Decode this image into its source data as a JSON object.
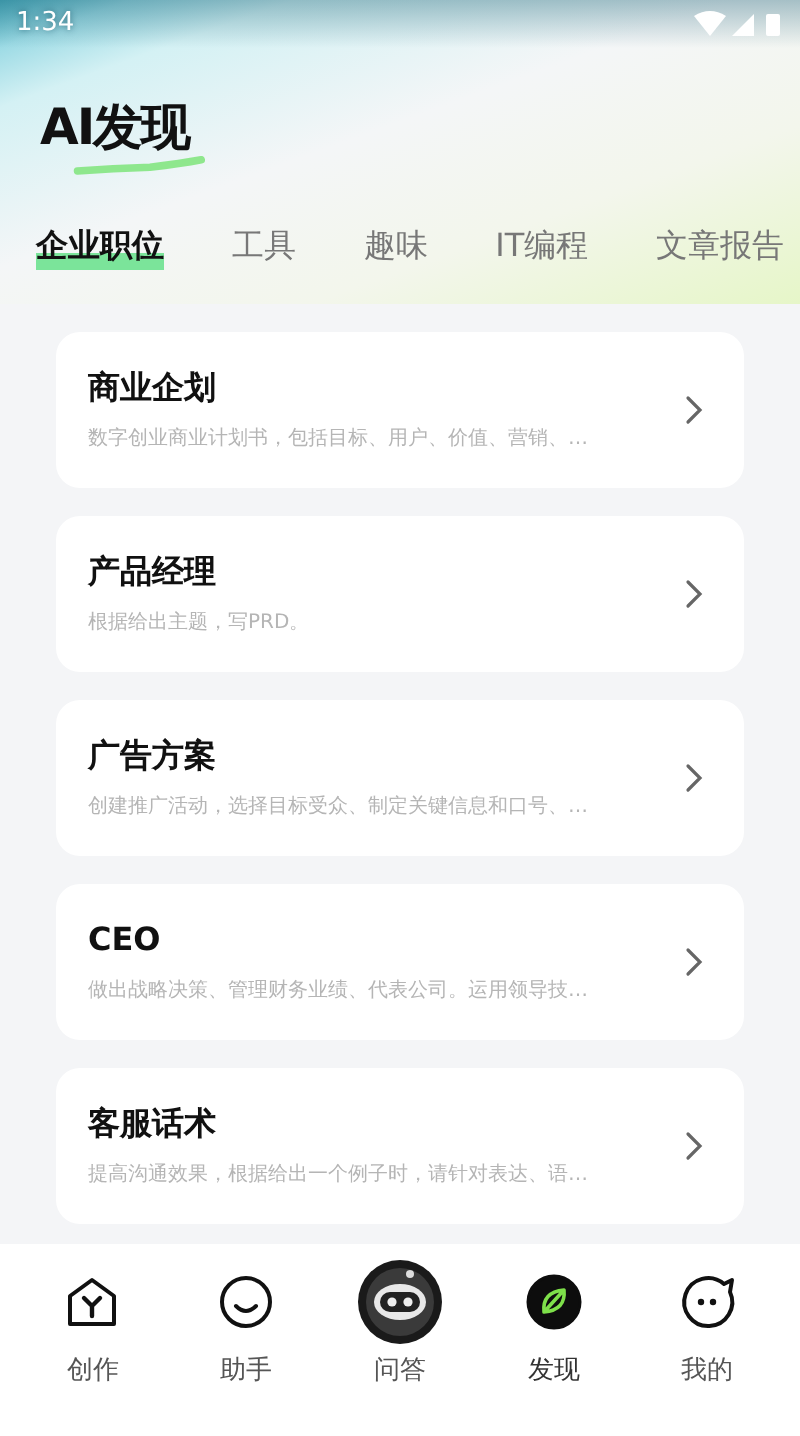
{
  "status_bar": {
    "time": "1:34"
  },
  "header": {
    "title": "AI发现"
  },
  "tabs": [
    {
      "label": "企业职位",
      "selected": true
    },
    {
      "label": "工具",
      "selected": false
    },
    {
      "label": "趣味",
      "selected": false
    },
    {
      "label": "IT编程",
      "selected": false
    },
    {
      "label": "文章报告",
      "selected": false
    }
  ],
  "cards": [
    {
      "title": "商业企划",
      "description": "数字创业商业计划书，包括目标、用户、价值、营销、…"
    },
    {
      "title": "产品经理",
      "description": "根据给出主题，写PRD。"
    },
    {
      "title": "广告方案",
      "description": "创建推广活动，选择目标受众、制定关键信息和口号、…"
    },
    {
      "title": "CEO",
      "description": "做出战略决策、管理财务业绩、代表公司。运用领导技…"
    },
    {
      "title": "客服话术",
      "description": "提高沟通效果，根据给出一个例子时，请针对表达、语…"
    }
  ],
  "bottom_nav": [
    {
      "kind": "home",
      "label": "创作",
      "selected": false
    },
    {
      "kind": "smile",
      "label": "助手",
      "selected": false
    },
    {
      "kind": "robot",
      "label": "问答",
      "selected": false
    },
    {
      "kind": "leaf",
      "label": "发现",
      "selected": true
    },
    {
      "kind": "chat",
      "label": "我的",
      "selected": false
    }
  ]
}
